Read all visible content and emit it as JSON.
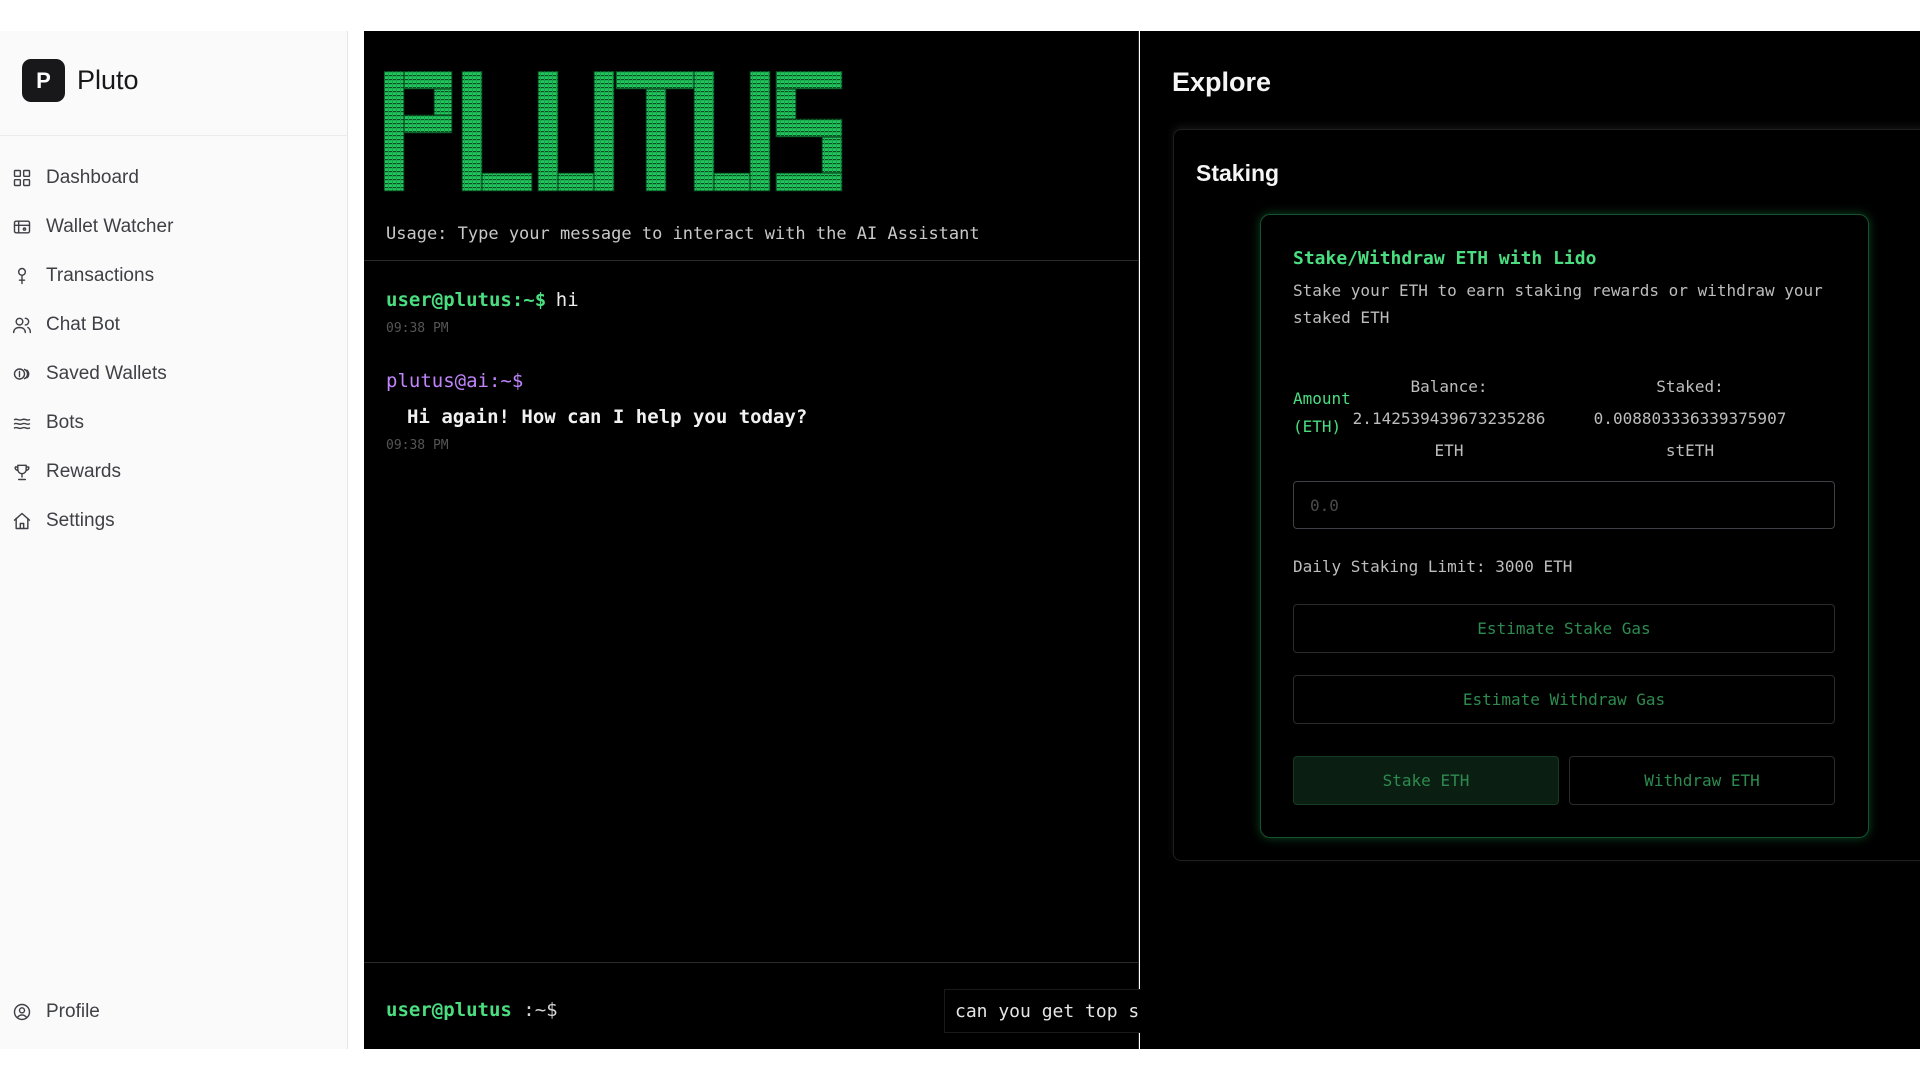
{
  "brand": {
    "logo_letter": "P",
    "name": "Pluto"
  },
  "sidebar": {
    "items": [
      {
        "label": "Dashboard",
        "icon": "grid-icon"
      },
      {
        "label": "Wallet Watcher",
        "icon": "wallet-icon"
      },
      {
        "label": "Transactions",
        "icon": "transactions-icon"
      },
      {
        "label": "Chat Bot",
        "icon": "users-icon"
      },
      {
        "label": "Saved Wallets",
        "icon": "coins-icon"
      },
      {
        "label": "Bots",
        "icon": "waves-icon"
      },
      {
        "label": "Rewards",
        "icon": "trophy-icon"
      },
      {
        "label": "Settings",
        "icon": "home-icon"
      }
    ],
    "profile_label": "Profile"
  },
  "terminal": {
    "banner": "PLUTUS",
    "usage": "Usage: Type your message to interact with the AI Assistant",
    "messages": [
      {
        "prompt": "user@plutus:~$",
        "text": "hi",
        "time": "09:38 PM"
      },
      {
        "prompt": "plutus@ai:~$",
        "text": "Hi again! How can I help you today?",
        "time": "09:38 PM"
      }
    ],
    "input_prompt_user": "user@plutus",
    "input_prompt_tail": " :~$",
    "input_value": "can you get top staking assets fromstak"
  },
  "explore": {
    "title": "Explore",
    "section_title": "Staking",
    "lido": {
      "title": "Stake/Withdraw ETH with Lido",
      "description": "Stake your ETH to earn staking rewards or withdraw your staked ETH",
      "amount_label": "Amount (ETH)",
      "balance_label": "Balance:",
      "balance_value": "2.142539439673235286",
      "balance_unit": "ETH",
      "staked_label": "Staked:",
      "staked_value": "0.008803336339375907",
      "staked_unit": "stETH",
      "amount_placeholder": "0.0",
      "daily_limit": "Daily Staking Limit: 3000 ETH",
      "estimate_stake_label": "Estimate Stake Gas",
      "estimate_withdraw_label": "Estimate Withdraw Gas",
      "stake_label": "Stake ETH",
      "withdraw_label": "Withdraw ETH"
    }
  },
  "colors": {
    "accent_green": "#4ade80",
    "ai_purple": "#c084fc",
    "terminal_bg": "#000000"
  }
}
